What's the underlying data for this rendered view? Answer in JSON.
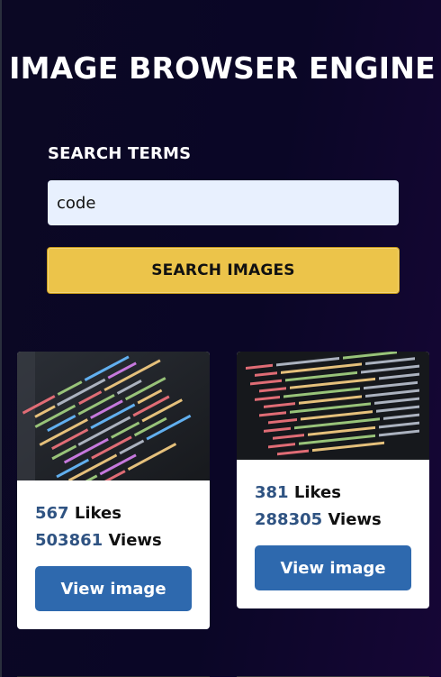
{
  "header": {
    "title": "IMAGE BROWSER ENGINE"
  },
  "search": {
    "label": "SEARCH TERMS",
    "value": "code",
    "button_label": "SEARCH IMAGES"
  },
  "results": [
    {
      "likes": "567",
      "likes_label": "Likes",
      "views": "503861",
      "views_label": "Views",
      "button_label": "View image"
    },
    {
      "likes": "381",
      "likes_label": "Likes",
      "views": "288305",
      "views_label": "Views",
      "button_label": "View image"
    }
  ],
  "colors": {
    "background": "#0b0824",
    "accent_button": "#ecc44a",
    "primary_button": "#2e69ae",
    "stat_number": "#2f5382"
  }
}
